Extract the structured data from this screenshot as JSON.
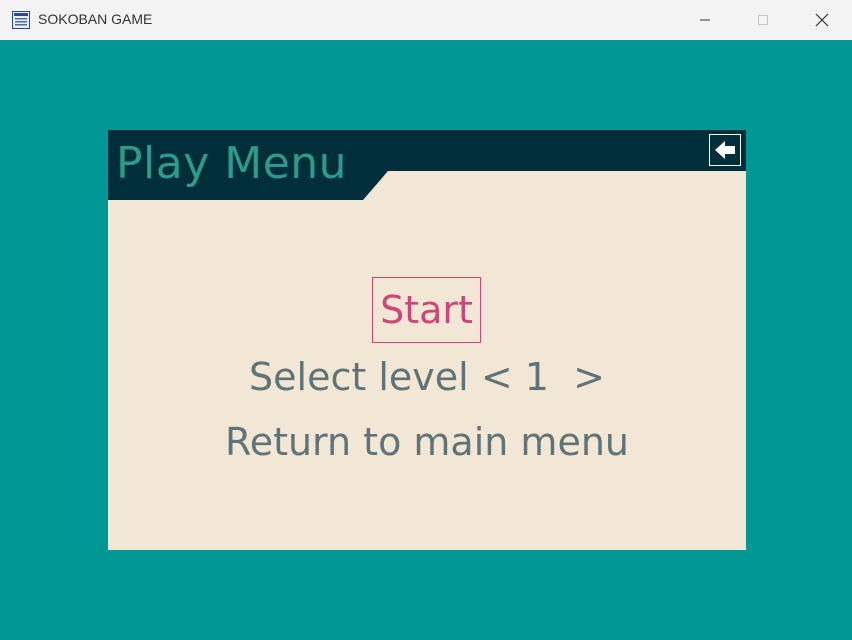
{
  "window": {
    "title": "SOKOBAN GAME",
    "controls": {
      "minimize": "—",
      "maximize": "☐",
      "close": "✕"
    }
  },
  "menu": {
    "title": "Play Menu",
    "start_label": "Start",
    "select_label": "Select level",
    "level_prev": "<",
    "level_value": "1",
    "level_next": ">",
    "return_label": "Return to main menu",
    "back_icon": "arrow-left-icon"
  },
  "colors": {
    "background": "#009795",
    "header": "#002e3a",
    "panel": "#f2e6d4",
    "title_text": "#2b9b8d",
    "accent": "#cf4479",
    "menu_text": "#5f7479"
  }
}
